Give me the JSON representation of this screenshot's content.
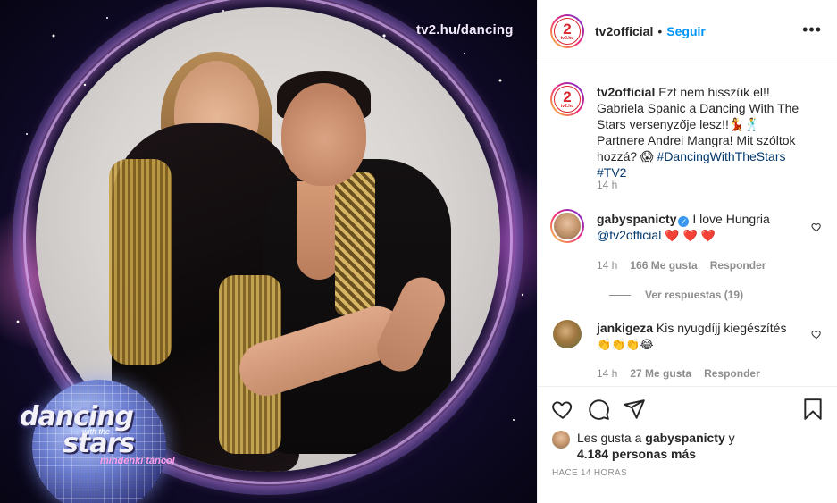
{
  "media": {
    "watermark": "tv2.hu/dancing",
    "logo_line1": "dancing",
    "logo_line2": "with the",
    "logo_line3": "stars",
    "logo_tagline": "mindenki táncol"
  },
  "header": {
    "account_name": "tv2official",
    "separator": "•",
    "follow_label": "Seguir",
    "more_label": "•••",
    "avatar_icon": "tv2-logo-icon",
    "avatar_mark_text": "2",
    "avatar_mark_sub": "tv2.hu"
  },
  "caption": {
    "username": "tv2official",
    "text_before_tag": "Ezt nem hisszük el!! Gabriela Spanic a Dancing With The Stars versenyzője lesz!!💃🕺 Partnere Andrei Mangra! Mit szóltok hozzá? 😱",
    "hashtag1": "#DancingWithTheStars",
    "hashtag2": "#TV2",
    "age": "14 h"
  },
  "comments": [
    {
      "username": "gabyspanicty",
      "text": "I love Hungria",
      "mention": "@tv2official",
      "emoji": "❤️ ❤️ ❤️",
      "age": "14 h",
      "likes": "166 Me gusta",
      "reply_label": "Responder",
      "view_replies": "Ver respuestas (19)",
      "verified": true
    },
    {
      "username": "jankigeza",
      "text": "Kis nyugdíjj kiegészítés",
      "emoji": "👏👏👏😂",
      "age": "14 h",
      "likes": "27 Me gusta",
      "reply_label": "Responder"
    }
  ],
  "actions": {
    "like_icon": "heart-icon",
    "comment_icon": "comment-icon",
    "share_icon": "paper-plane-icon",
    "save_icon": "bookmark-icon"
  },
  "likes": {
    "prefix": "Les gusta a",
    "user": "gabyspanicty",
    "suffix": "y",
    "others": "4.184 personas más"
  },
  "timestamp": "HACE 14 HORAS",
  "colors": {
    "link": "#0095f6",
    "tag": "#00376b",
    "muted": "#8e8e8e",
    "text": "#262626",
    "like_red": "#ed4956"
  }
}
